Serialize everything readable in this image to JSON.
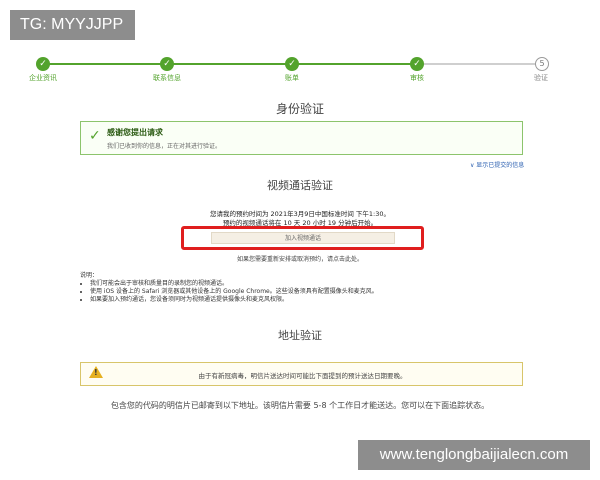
{
  "watermark": {
    "tag": "TG: MYYJJPP",
    "site": "www.tenglongbaijialecn.com"
  },
  "stepper": {
    "steps": [
      {
        "label": "企业资讯",
        "status": "done"
      },
      {
        "label": "联系信息",
        "status": "done"
      },
      {
        "label": "账单",
        "status": "done"
      },
      {
        "label": "审核",
        "status": "done"
      },
      {
        "label": "验证",
        "status": "current",
        "number": "5"
      }
    ],
    "check_glyph": "✓"
  },
  "identity": {
    "title": "身份验证",
    "success": {
      "title": "感谢您提出请求",
      "desc": "我们已收到你的信息，正在对其进行验证。"
    },
    "toggle_link": "∨ 显示已提交的信息"
  },
  "video": {
    "title": "视频通话验证",
    "line1": "您请我的预约时间为 2021年3月9日中国标准时间 下午1:30。",
    "line2": "预约的视频通话将在 10 天 20 小时 19 分钟后开始。",
    "join_button": "加入视频通话",
    "reschedule": "如果您需要重新安排或取消预约，请点击此处。"
  },
  "notes": {
    "heading": "说明：",
    "items": [
      "我们可能会出于审核和质量目的录制您的视频通话。",
      "使用 iOS 设备上的 Safari 浏览器或其他设备上的 Google Chrome。这些设备须具有配置摄像头和麦克风。",
      "如果要加入预约通话，您设备须同时为视频通话提供摄像头和麦克风权限。"
    ]
  },
  "address": {
    "title": "地址验证",
    "warning": "由于有新冠病毒，明信片送达时间可能比下面提到的预计送达日期要晚。",
    "postcard_note": "包含您的代码的明信片已邮寄到以下地址。该明信片需要 5-8 个工作日才能送达。您可以在下面追踪状态。"
  },
  "colors": {
    "accent_green": "#53a32c",
    "highlight_red": "#e01e1e",
    "warning_yellow": "#e6b020"
  }
}
